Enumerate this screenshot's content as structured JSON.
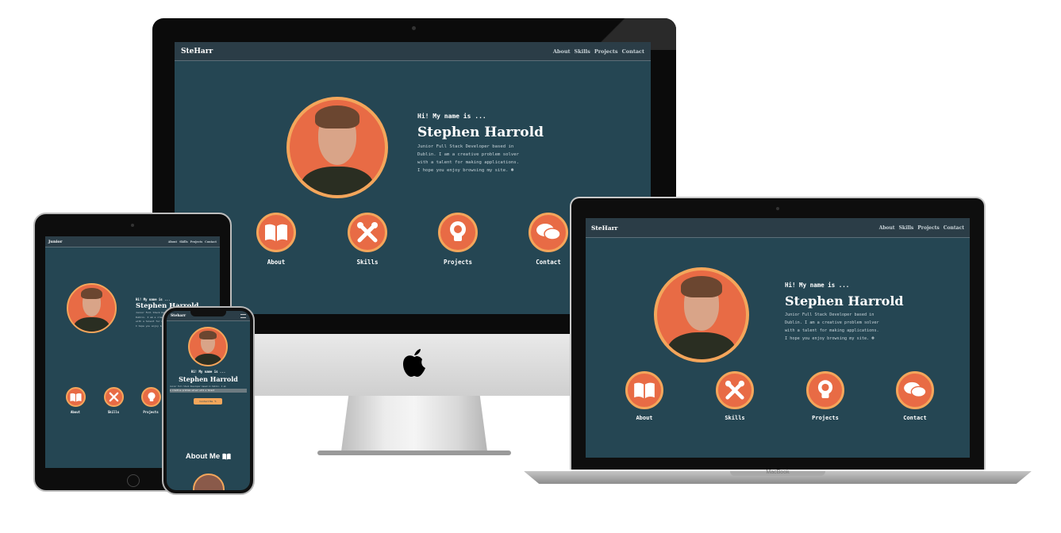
{
  "site": {
    "brand": "SteHarr",
    "nav": [
      "About",
      "Skills",
      "Projects",
      "Contact"
    ],
    "greeting": "Hi! My name is ...",
    "name": "Stephen Harrold",
    "bio": [
      "Junior Full Stack Developer based in",
      "Dublin. I am a creative problem solver",
      "with a talent for making applications.",
      "I hope you enjoy browsing my site."
    ],
    "bio_emoji": "☻",
    "sections": [
      {
        "label": "About",
        "icon": "book-icon"
      },
      {
        "label": "Skills",
        "icon": "tools-icon"
      },
      {
        "label": "Projects",
        "icon": "lightbulb-icon"
      },
      {
        "label": "Contact",
        "icon": "chat-bubbles-icon"
      }
    ]
  },
  "tablet": {
    "brand": "Junior"
  },
  "phone": {
    "brand": "Steharr",
    "bio_line1": "Junior Full Stack Developer based in Dublin. I am",
    "bio_line2": "a creative problem solver with a talent",
    "contact_button": "Contact Me",
    "contact_icon": "✎",
    "about_heading": "About Me",
    "about_icon": "book-icon"
  },
  "laptop": {
    "label": "MacBook"
  },
  "colors": {
    "bg": "#254653",
    "accent": "#e86b45",
    "ring": "#f4a65b",
    "nav": "#2b3d47"
  }
}
